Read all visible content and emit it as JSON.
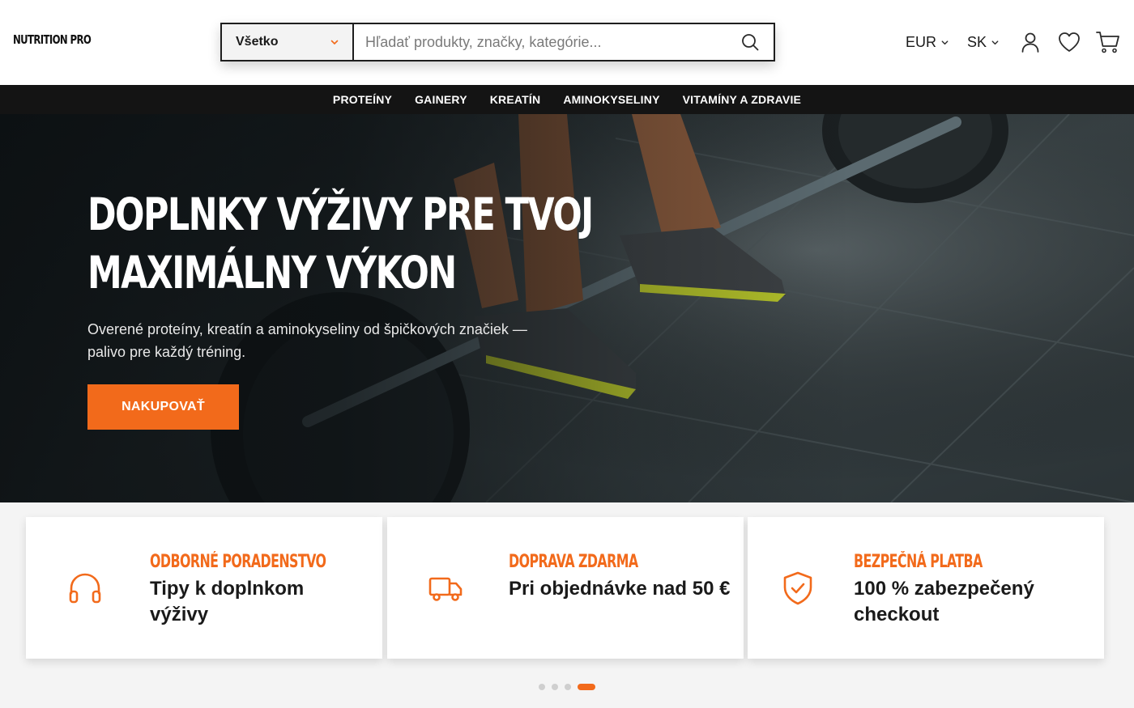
{
  "brand": {
    "logo_text": "NUTRITION PRO",
    "accent": "#f26a1b",
    "dark": "#141414"
  },
  "search": {
    "category": "Všetko",
    "placeholder": "Hľadať produkty, značky, kategórie...",
    "value": ""
  },
  "header": {
    "currency": "EUR",
    "language": "SK",
    "icons": [
      "account-icon",
      "wishlist-heart-icon",
      "cart-icon"
    ]
  },
  "nav": {
    "items": [
      "PROTEÍNY",
      "GAINERY",
      "KREATÍN",
      "AMINOKYSELINY",
      "VITAMÍNY A ZDRAVIE"
    ]
  },
  "hero": {
    "title_line1": "DOPLNKY VÝŽIVY PRE TVOJ",
    "title_line2": "MAXIMÁLNY VÝKON",
    "subtitle": "Overené proteíny, kreatín a aminokyseliny od špičkových značiek — palivo pre každý tréning.",
    "cta": "NAKUPOVAŤ",
    "image": "weightlifter-deadlift-photo"
  },
  "features": [
    {
      "icon": "headphones-icon",
      "title": "ODBORNÉ PORADENSTVO",
      "text": "Tipy k doplnkom výživy"
    },
    {
      "icon": "truck-icon",
      "title": "DOPRAVA ZDARMA",
      "text": "Pri objednávke nad 50 €"
    },
    {
      "icon": "shield-check-icon",
      "title": "BEZPEČNÁ PLATBA",
      "text": "100 % zabezpečený checkout"
    }
  ],
  "carousel": {
    "dots": 4,
    "active_index": 3
  }
}
